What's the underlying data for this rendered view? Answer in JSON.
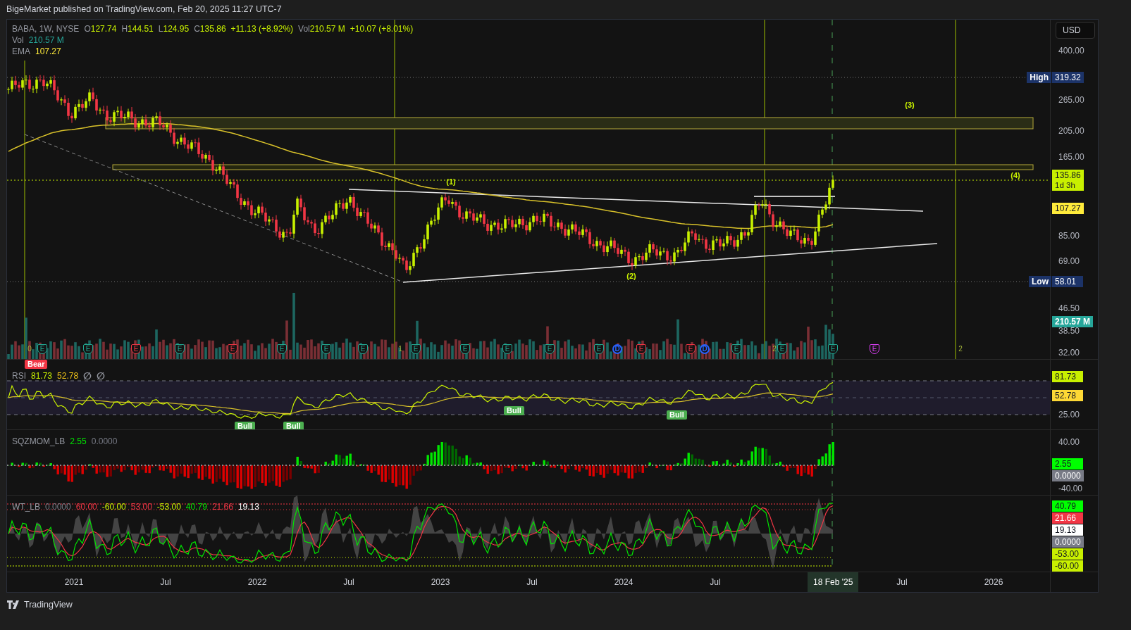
{
  "header": {
    "text": "BigeMarket published on TradingView.com, Feb 20, 2025 11:27 UTC-7"
  },
  "main_pane": {
    "legend": {
      "symbol": "BABA, 1W, NYSE",
      "fields": [
        {
          "label": "O",
          "value": "127.74"
        },
        {
          "label": "H",
          "value": "144.51"
        },
        {
          "label": "L",
          "value": "124.95"
        },
        {
          "label": "C",
          "value": "135.86"
        },
        {
          "value": "+11.13 (+8.92%)"
        },
        {
          "label": "Vol",
          "value": "210.57 M"
        },
        {
          "value": "+10.07 (+8.01%)"
        }
      ]
    },
    "volume_legend": {
      "label": "Vol",
      "value": "210.57 M"
    },
    "ema_legend": {
      "label": "EMA",
      "value": "107.27"
    },
    "currency": "USD",
    "price_ticks": [
      "400.00",
      "265.00",
      "205.00",
      "165.00",
      "85.00",
      "69.00",
      "46.50",
      "38.50",
      "32.00"
    ],
    "price_tags": [
      {
        "kind": "high",
        "label": "High",
        "value": "319.32",
        "color": "#1c3368"
      },
      {
        "kind": "last",
        "value": "135.86",
        "sub": "1d 3h",
        "color": "#c8f000"
      },
      {
        "kind": "ema",
        "value": "107.27",
        "color": "#ffeb3b"
      },
      {
        "kind": "low",
        "label": "Low",
        "value": "58.01",
        "color": "#1c3368"
      },
      {
        "kind": "volume",
        "value": "210.57 M",
        "color": "#26a69a"
      }
    ],
    "wave_labels": [
      "(1)",
      "(2)",
      "(3)",
      "(4)"
    ],
    "event_markers": [
      {
        "kind": "earnings",
        "letter": "E",
        "color": "#22ab94"
      },
      {
        "kind": "earnings",
        "letter": "E",
        "color": "#22ab94"
      },
      {
        "kind": "earnings",
        "letter": "E",
        "color": "#f23645"
      },
      {
        "kind": "earnings",
        "letter": "E",
        "color": "#22ab94"
      },
      {
        "kind": "earnings",
        "letter": "E",
        "color": "#f23645"
      },
      {
        "kind": "earnings",
        "letter": "E",
        "color": "#22ab94"
      },
      {
        "kind": "earnings",
        "letter": "E",
        "color": "#22ab94"
      },
      {
        "kind": "earnings",
        "letter": "E",
        "color": "#22ab94"
      },
      {
        "kind": "earnings",
        "letter": "E",
        "color": "#22ab94"
      },
      {
        "kind": "earnings",
        "letter": "E",
        "color": "#22ab94"
      },
      {
        "kind": "earnings",
        "letter": "E",
        "color": "#22ab94"
      },
      {
        "kind": "earnings",
        "letter": "E",
        "color": "#22ab94"
      },
      {
        "kind": "earnings",
        "letter": "E",
        "color": "#22ab94"
      },
      {
        "kind": "dividend",
        "letter": "D",
        "color": "#2962ff"
      },
      {
        "kind": "earnings",
        "letter": "E",
        "color": "#f23645"
      },
      {
        "kind": "earnings",
        "letter": "E",
        "color": "#f23645"
      },
      {
        "kind": "dividend",
        "letter": "D",
        "color": "#2962ff"
      },
      {
        "kind": "earnings",
        "letter": "E",
        "color": "#22ab94"
      },
      {
        "kind": "earnings",
        "letter": "E",
        "color": "#22ab94"
      },
      {
        "kind": "earnings",
        "letter": "E",
        "color": "#22ab94"
      },
      {
        "kind": "earnings",
        "letter": "E",
        "color": "#e040fb"
      }
    ],
    "count_marks": [
      "0",
      "1",
      "2",
      "2"
    ]
  },
  "rsi_pane": {
    "legend": {
      "name": "RSI",
      "values": [
        {
          "text": "81.73",
          "color": "#c8f000"
        },
        {
          "text": "52.78",
          "color": "#f0c419"
        },
        {
          "text": "∅",
          "color": "#9598a1"
        },
        {
          "text": "∅",
          "color": "#9598a1"
        }
      ]
    },
    "divergence_tags": [
      {
        "kind": "bear",
        "text": "Bear"
      },
      {
        "kind": "bull",
        "text": "Bull"
      },
      {
        "kind": "bull",
        "text": "Bull"
      },
      {
        "kind": "bull",
        "text": "Bull"
      },
      {
        "kind": "bull",
        "text": "Bull"
      }
    ],
    "ticks": [
      "25.00"
    ],
    "tags": [
      {
        "value": "81.73",
        "color": "#c8f000"
      },
      {
        "value": "52.78",
        "color": "#fdd835"
      }
    ]
  },
  "sqz_pane": {
    "legend": {
      "name": "SQZMOM_LB",
      "values": [
        {
          "text": "2.55",
          "color": "#00e600"
        },
        {
          "text": "0.0000",
          "color": "#787b86"
        }
      ]
    },
    "ticks": [
      "40.00",
      "-40.00"
    ],
    "tags": [
      {
        "value": "2.55",
        "color": "#00ff00"
      },
      {
        "value": "0.0000",
        "color": "#787b86"
      }
    ]
  },
  "wt_pane": {
    "legend": {
      "name": "WT_LB",
      "values": [
        {
          "text": "0.0000",
          "color": "#787b86"
        },
        {
          "text": "60.00",
          "color": "#f23645"
        },
        {
          "text": "-60.00",
          "color": "#c8f000"
        },
        {
          "text": "53.00",
          "color": "#f23645"
        },
        {
          "text": "-53.00",
          "color": "#c8f000"
        },
        {
          "text": "40.79",
          "color": "#00e600"
        },
        {
          "text": "21.66",
          "color": "#f23645"
        },
        {
          "text": "19.13",
          "color": "#ffffff"
        }
      ]
    },
    "tags": [
      {
        "value": "40.79",
        "color": "#00ff00"
      },
      {
        "value": "21.66",
        "color": "#f23645"
      },
      {
        "value": "19.13",
        "color": "#ffffff"
      },
      {
        "value": "0.0000",
        "color": "#787b86"
      },
      {
        "value": "-53.00",
        "color": "#c8f000"
      },
      {
        "value": "-60.00",
        "color": "#c8f000"
      }
    ]
  },
  "time_axis": {
    "labels": [
      "2021",
      "Jul",
      "2022",
      "Jul",
      "2023",
      "Jul",
      "2024",
      "Jul",
      "Jul",
      "2026"
    ],
    "cursor_label": "18 Feb '25"
  },
  "footer": {
    "brand": "TradingView"
  }
}
